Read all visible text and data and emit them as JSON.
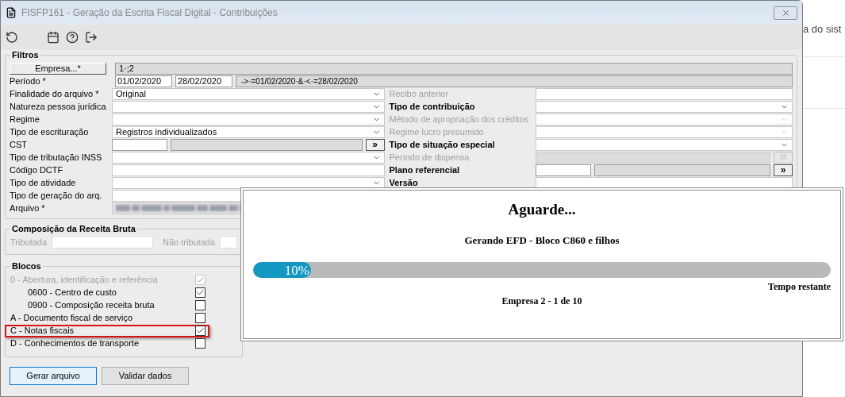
{
  "window": {
    "title": "FISFP161 - Geração da Escrita Fiscal Digital - Contribuições"
  },
  "filters": {
    "title": "Filtros",
    "empresa": {
      "button": "Empresa...*",
      "value": "1·;2"
    },
    "periodo": {
      "label": "Período *",
      "start": "01/02/2020",
      "end": "28/02/2020",
      "expression": "->·=01/02/2020·&·<·=28/02/2020"
    },
    "left": [
      {
        "label": "Finalidade do arquivo *",
        "kind": "select",
        "value": "Original"
      },
      {
        "label": "Natureza pessoa jurídica",
        "kind": "select"
      },
      {
        "label": "Regime",
        "kind": "select"
      },
      {
        "label": "Tipo de escrituração",
        "kind": "select",
        "value": "Registros individualizados"
      },
      {
        "label": "CST",
        "kind": "lookup",
        "button": "»"
      },
      {
        "label": "Tipo de tributação INSS",
        "kind": "select"
      },
      {
        "label": "Código DCTF",
        "kind": "text"
      },
      {
        "label": "Tipo de atividade",
        "kind": "select"
      },
      {
        "label": "Tipo de geração do arq.",
        "kind": "text"
      },
      {
        "label": "Arquivo *",
        "kind": "blurred"
      }
    ],
    "right": [
      {
        "label": "Recibo anterior",
        "kind": "text",
        "disabled": true
      },
      {
        "label": "Tipo de contribuição",
        "kind": "select",
        "disabled": false
      },
      {
        "label": "Método de apropriação dos créditos",
        "kind": "select",
        "disabled": true
      },
      {
        "label": "Regime lucro presumido",
        "kind": "select",
        "disabled": true
      },
      {
        "label": "Tipo de situação especial",
        "kind": "select",
        "disabled": false
      },
      {
        "label": "Período de dispensa",
        "kind": "picker",
        "disabled": true
      },
      {
        "label": "Plano referencial",
        "kind": "lookup",
        "button": "»",
        "disabled": false
      },
      {
        "label": "Versão",
        "kind": "text",
        "disabled": false
      }
    ]
  },
  "receita": {
    "title": "Composição da Receita Bruta",
    "fields": [
      {
        "label": "Tributada"
      },
      {
        "label": "Não tributada"
      }
    ]
  },
  "blocks": {
    "title": "Blocos",
    "items": [
      {
        "label": "0 - Abertura, identificação e referência",
        "checked": true,
        "disabled": true,
        "highlighted": false,
        "children": [
          {
            "label": "0600 - Centro de custo",
            "checked": true,
            "disabled": false,
            "highlighted": false
          },
          {
            "label": "0900 - Composição receita bruta",
            "checked": false,
            "disabled": false,
            "highlighted": false
          }
        ]
      },
      {
        "label": "A - Documento fiscal de serviço",
        "checked": false,
        "disabled": false,
        "highlighted": false
      },
      {
        "label": "C - Notas fiscais",
        "checked": true,
        "disabled": false,
        "highlighted": true
      },
      {
        "label": "D - Conhecimentos de transporte",
        "checked": false,
        "disabled": false,
        "highlighted": false
      }
    ]
  },
  "buttons": [
    {
      "label": "Gerar arquivo",
      "selected": true
    },
    {
      "label": "Validar dados",
      "selected": false
    }
  ],
  "progress": {
    "title": "Aguarde...",
    "message": "Gerando EFD - Bloco C860 e filhos",
    "level": 0.1,
    "percent": "10%",
    "remaining": "Tempo restante",
    "status": "Empresa 2 - 1 de 10"
  },
  "background": {
    "text": "a do sist"
  }
}
